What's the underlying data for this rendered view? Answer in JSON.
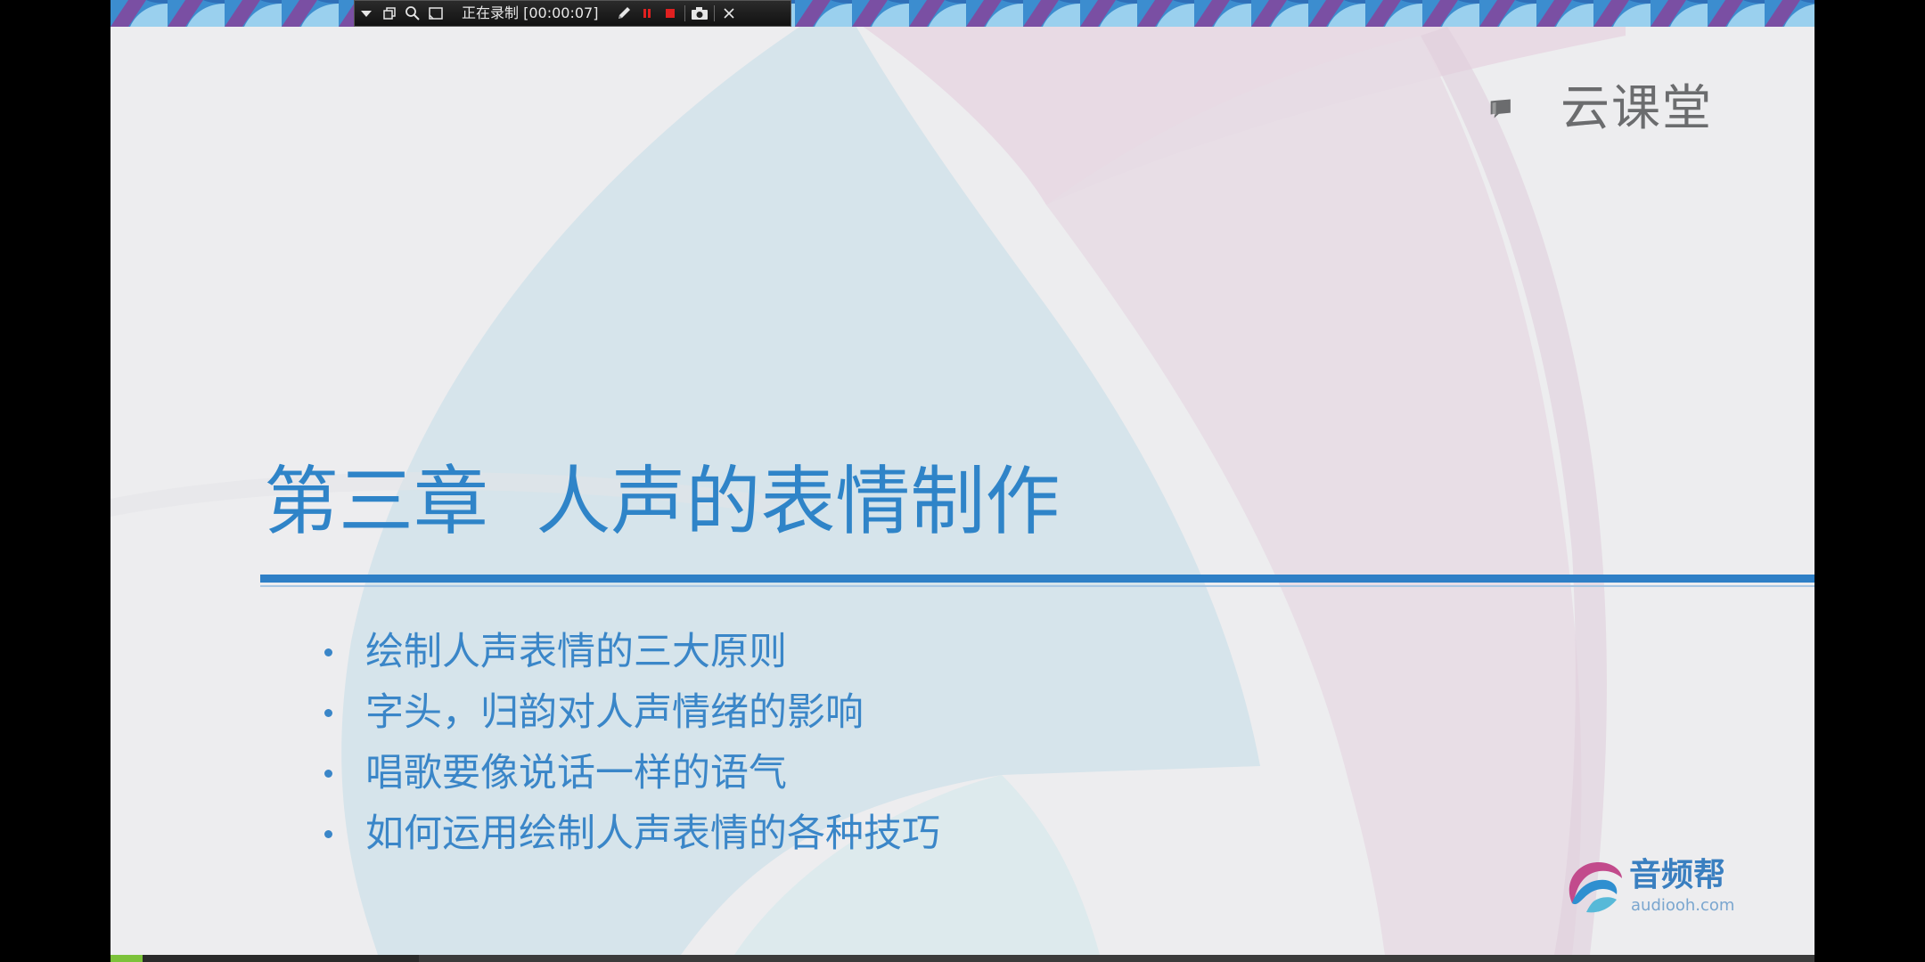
{
  "recording_toolbar": {
    "status": "正在录制 [00:00:07]",
    "icons": [
      "dropdown-arrow-icon",
      "window-restore-icon",
      "zoom-icon",
      "region-select-icon",
      "pen-icon",
      "pause-icon",
      "stop-icon",
      "camera-icon",
      "close-icon"
    ]
  },
  "slide": {
    "brand_logo": {
      "name": "云课堂",
      "icon": "chat-bubble-icon"
    },
    "title": "第三章  人声的表情制作",
    "bullets": [
      "绘制人声表情的三大原则",
      "字头，归韵对人声情绪的影响",
      "唱歌要像说话一样的语气",
      "如何运用绘制人声表情的各种技巧"
    ],
    "footer_logo": {
      "name": "音频帮",
      "url": "audiooh.com",
      "icon": "swirl-logo-icon"
    }
  },
  "colors": {
    "title_blue": "#2f84c8",
    "bullet_blue": "#3a86c8",
    "slide_background": "#ededef",
    "logo_gray": "#6b6c6e",
    "recording_red": "#e02020"
  }
}
